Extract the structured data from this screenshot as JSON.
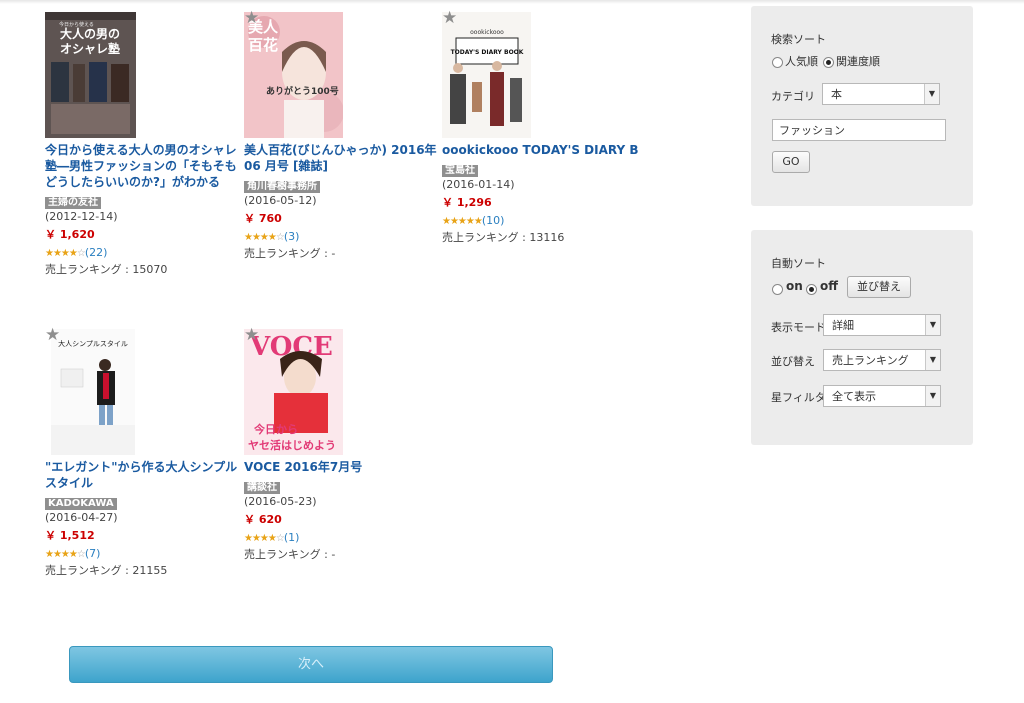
{
  "products": [
    {
      "title": "今日から使える大人の男のオシャレ塾―男性ファッションの「そもそもどうしたらいいのか?」がわかる",
      "publisher": "主婦の友社",
      "date": "(2012-12-14)",
      "price": "￥ 1,620",
      "stars": "★★★★",
      "stars_empty": "☆",
      "reviews": "(22)",
      "rank": "売上ランキング : 15070",
      "cover_text_1": "大人の男の",
      "cover_text_2": "オシャレ塾",
      "cover_text_3": "今日から使える"
    },
    {
      "title": "美人百花(びじんひゃっか) 2016年 06 月号 [雑誌]",
      "publisher": "角川春樹事務所",
      "date": "(2016-05-12)",
      "price": "￥ 760",
      "stars": "★★★★",
      "stars_empty": "☆",
      "reviews": "(3)",
      "rank": "売上ランキング : -",
      "cover_text_1": "美人",
      "cover_text_2": "百花",
      "cover_text_3": "ありがとう100号"
    },
    {
      "title": "oookickooo TODAY'S DIARY BOOK",
      "publisher": "宝島社",
      "date": "(2016-01-14)",
      "price": "￥ 1,296",
      "stars": "★★★★★",
      "stars_empty": "",
      "reviews": "(10)",
      "rank": "売上ランキング : 13116",
      "cover_text_1": "oookickooo",
      "cover_text_2": "TODAY'S DIARY BOOK"
    },
    {
      "title": "\"エレガント\"から作る大人シンプルスタイル",
      "publisher": "KADOKAWA",
      "date": "(2016-04-27)",
      "price": "￥ 1,512",
      "stars": "★★★★",
      "stars_empty": "☆",
      "reviews": "(7)",
      "rank": "売上ランキング : 21155",
      "cover_text_1": "大人シンプルスタイル"
    },
    {
      "title": "VOCE 2016年7月号",
      "publisher": "講談社",
      "date": "(2016-05-23)",
      "price": "￥ 620",
      "stars": "★★★★",
      "stars_empty": "☆",
      "reviews": "(1)",
      "rank": "売上ランキング : -",
      "cover_text_1": "VOCE",
      "cover_text_2": "今日から",
      "cover_text_3": "ヤセ活はじめよう"
    }
  ],
  "fav_icon": "★",
  "search_panel": {
    "sort_label": "検索ソート",
    "sort_options": [
      "人気順",
      "関連度順"
    ],
    "selected_sort": "関連度順",
    "category_label": "カテゴリ",
    "category_value": "本",
    "keyword_value": "ファッション",
    "go_label": "GO"
  },
  "auto_panel": {
    "auto_sort_label": "自動ソート",
    "on_label": "on",
    "off_label": "off",
    "selected": "off",
    "reorder_button": "並び替え",
    "display_mode_label": "表示モード",
    "display_mode_value": "詳細",
    "sort_label": "並び替え",
    "sort_value": "売上ランキング",
    "star_filter_label": "星フィルタ",
    "star_filter_value": "全て表示"
  },
  "next_label": "次へ",
  "dropdown_arrow": "▼",
  "colors": {
    "title_link": "#1a5aa0",
    "price": "#cc0000",
    "publisher_badge": "#8f8f8f",
    "panel_bg": "#ececec",
    "next_button": "#4aaad0",
    "stars": "#e8a317"
  }
}
